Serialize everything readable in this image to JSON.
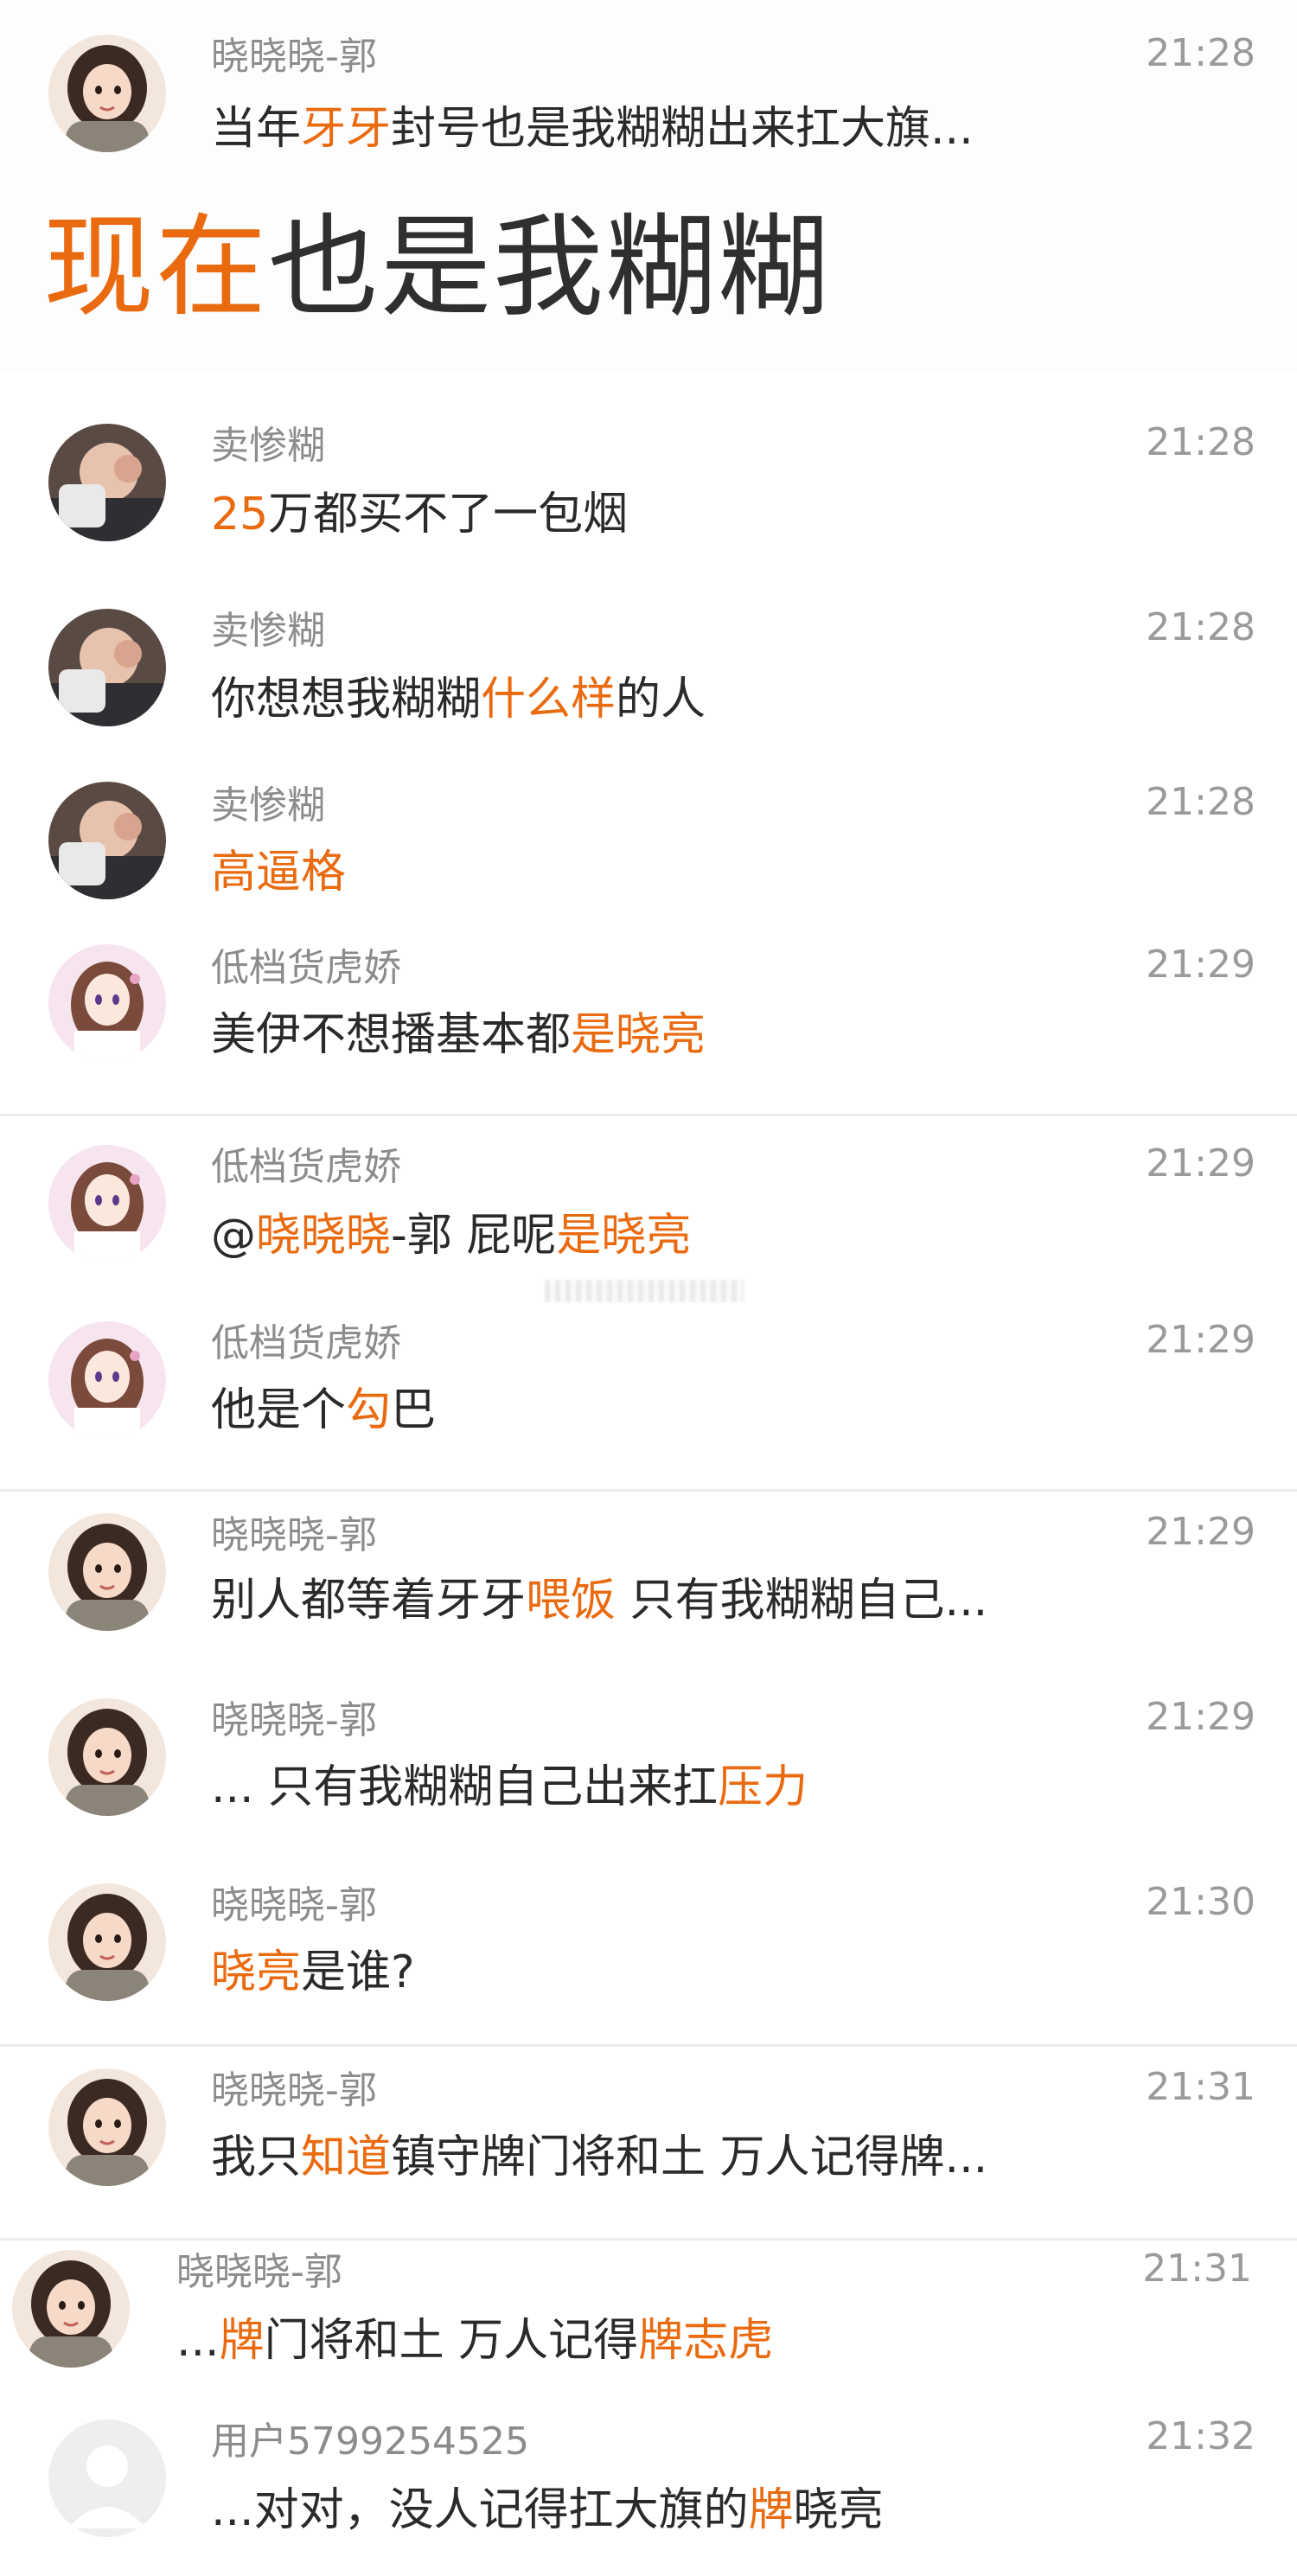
{
  "colors": {
    "highlight": "#ea6a10",
    "text": "#2a2a2a",
    "meta": "#8c8c8c",
    "divider": "#ececec"
  },
  "big_overlay": {
    "part1": "现在",
    "part2": "也是我糊糊"
  },
  "messages": [
    {
      "avatar": "girl-cartoon-avatar",
      "name": "晓晓晓-郭",
      "time": "21:28",
      "segments": [
        "当年",
        "牙牙",
        "封号也是我糊糊出来扛大旗..."
      ]
    },
    {
      "avatar": "photo-avatar",
      "name": "卖惨糊",
      "time": "21:28",
      "segments": [
        "",
        "25",
        "万都买不了一包烟"
      ]
    },
    {
      "avatar": "photo-avatar",
      "name": "卖惨糊",
      "time": "21:28",
      "segments": [
        "你想想我糊糊",
        "什么样",
        "的人"
      ]
    },
    {
      "avatar": "photo-avatar",
      "name": "卖惨糊",
      "time": "21:28",
      "segments": [
        "",
        "高逼格",
        ""
      ]
    },
    {
      "avatar": "anime-girl-avatar",
      "name": "低档货虎娇",
      "time": "21:29",
      "segments": [
        "美伊不想播基本都",
        "是晓亮",
        ""
      ]
    },
    {
      "avatar": "anime-girl-avatar",
      "name": "低档货虎娇",
      "time": "21:29",
      "segments": [
        "@",
        "晓晓晓",
        "-郭 屁呢",
        "是晓亮",
        ""
      ]
    },
    {
      "avatar": "anime-girl-avatar",
      "name": "低档货虎娇",
      "time": "21:29",
      "segments": [
        "他是个",
        "勾",
        "巴"
      ]
    },
    {
      "avatar": "girl-cartoon-avatar",
      "name": "晓晓晓-郭",
      "time": "21:29",
      "segments": [
        "别人都等着牙牙",
        "喂饭",
        "  只有我糊糊自己..."
      ]
    },
    {
      "avatar": "girl-cartoon-avatar",
      "name": "晓晓晓-郭",
      "time": "21:29",
      "segments": [
        "... 只有我糊糊自己出来扛",
        "压力",
        ""
      ]
    },
    {
      "avatar": "girl-cartoon-avatar",
      "name": "晓晓晓-郭",
      "time": "21:30",
      "segments": [
        "",
        "晓亮",
        "是谁?"
      ]
    },
    {
      "avatar": "girl-cartoon-avatar",
      "name": "晓晓晓-郭",
      "time": "21:31",
      "segments": [
        "我只",
        "知道",
        "镇守牌门将和土  万人记得牌..."
      ]
    },
    {
      "avatar": "girl-cartoon-avatar",
      "name": "晓晓晓-郭",
      "time": "21:31",
      "segments": [
        "...",
        "牌",
        "门将和土  万人记得",
        "牌志虎",
        ""
      ]
    },
    {
      "avatar": "default-user-icon",
      "name": "用户5799254525",
      "time": "21:32",
      "segments": [
        "...对对，没人记得扛大旗的",
        "牌",
        "晓亮"
      ]
    }
  ]
}
